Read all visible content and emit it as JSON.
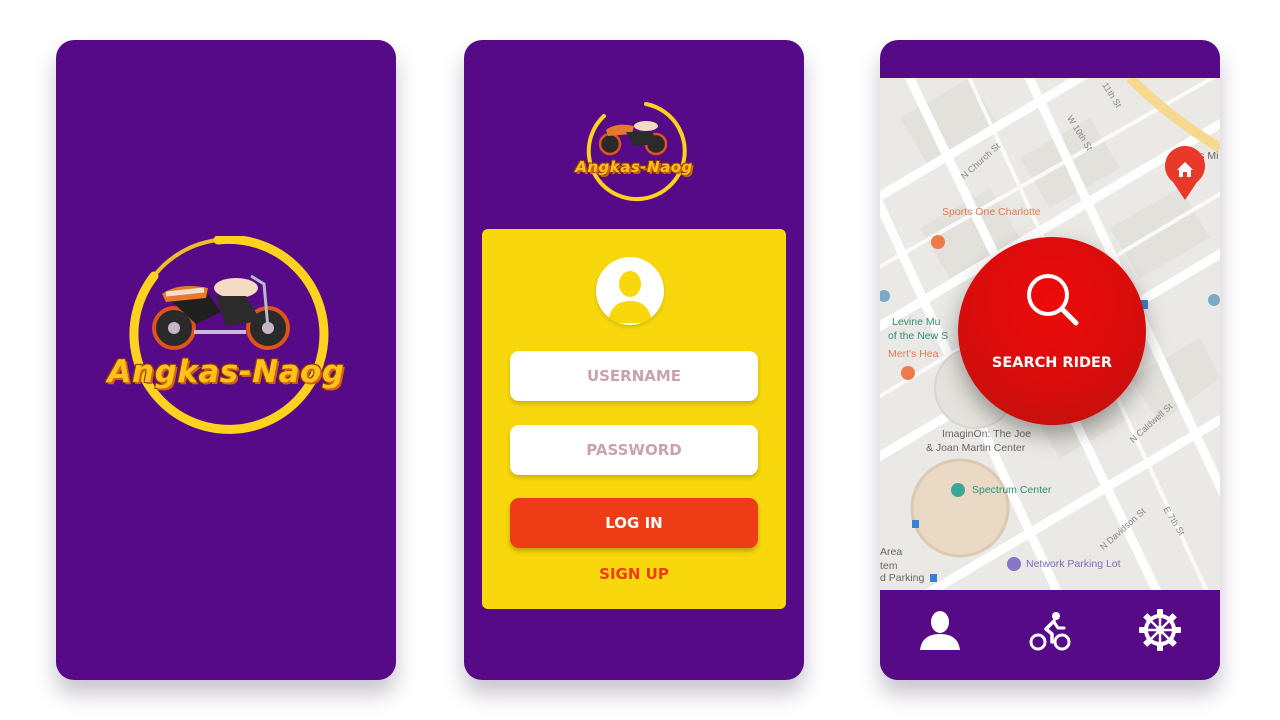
{
  "brand": {
    "name": "Angkas-Naog"
  },
  "login": {
    "username_placeholder": "USERNAME",
    "password_placeholder": "PASSWORD",
    "login_label": "LOG IN",
    "signup_label": "SIGN UP"
  },
  "map": {
    "search_label": "SEARCH RIDER",
    "places": {
      "sports": "Sports One Charlotte",
      "levine1": "Levine Mu",
      "levine2": "of the New S",
      "merts": "Mert's Hea",
      "imaginon1": "ImaginOn: The Joe",
      "imaginon2": "& Joan Martin Center",
      "spectrum": "Spectrum Center",
      "network": "Network Parking Lot",
      "area1": "Area",
      "area2": "tem",
      "parking": "d Parking",
      "alps": "Alps Mi",
      "church": "N Church St",
      "tenth": "W 10th St",
      "caldwell": "N Caldwell St",
      "davidson": "N Davidson St",
      "seventh": "E 7th St",
      "eleventh": "11th St"
    }
  },
  "nav": {
    "icons": [
      "profile-icon",
      "cyclist-icon",
      "settings-icon"
    ]
  },
  "colors": {
    "purple": "#560a87",
    "yellow": "#f8d80c",
    "red": "#ee3c16",
    "search_red": "#d80c0c"
  }
}
